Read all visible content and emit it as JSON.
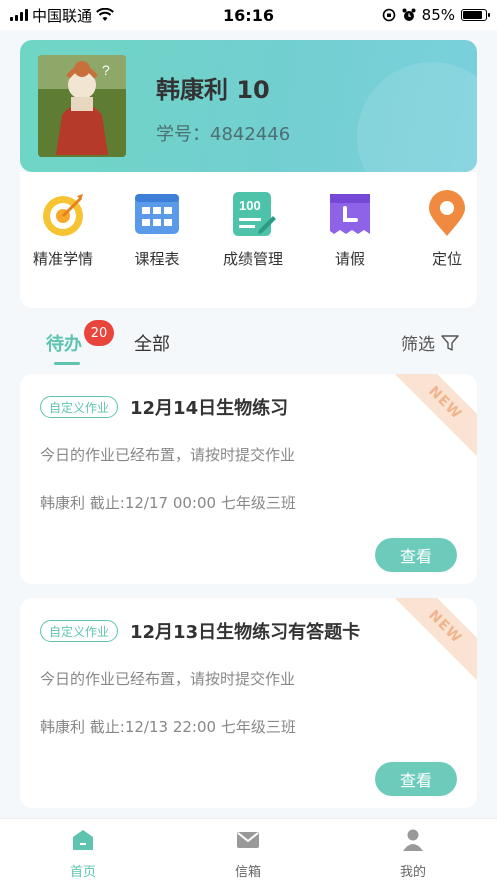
{
  "status_bar": {
    "carrier": "中国联通",
    "time": "16:16",
    "battery": "85%",
    "battery_level": 0.85
  },
  "profile": {
    "name": "韩康利 10",
    "student_id_label": "学号：",
    "student_id": "4842446"
  },
  "quick_actions": [
    {
      "label": "精准学情",
      "icon": "target-icon"
    },
    {
      "label": "课程表",
      "icon": "calendar-grid-icon"
    },
    {
      "label": "成绩管理",
      "icon": "score-icon"
    },
    {
      "label": "请假",
      "icon": "leave-icon"
    },
    {
      "label": "定位",
      "icon": "location-pin-icon"
    }
  ],
  "tabs": {
    "todo": "待办",
    "todo_badge": "20",
    "all": "全部",
    "filter": "筛选"
  },
  "tasks": [
    {
      "tag": "自定义作业",
      "title": "12月14日生物练习",
      "description": "今日的作业已经布置，请按时提交作业",
      "meta": "韩康利 截止:12/17 00:00  七年级三班",
      "button": "查看",
      "ribbon": "NEW"
    },
    {
      "tag": "自定义作业",
      "title": "12月13日生物练习有答题卡",
      "description": "今日的作业已经布置，请按时提交作业",
      "meta": "韩康利 截止:12/13 22:00  七年级三班",
      "button": "查看",
      "ribbon": "NEW"
    }
  ],
  "bottom_nav": [
    {
      "label": "首页",
      "icon": "home-icon",
      "active": true
    },
    {
      "label": "信箱",
      "icon": "mail-icon",
      "active": false
    },
    {
      "label": "我的",
      "icon": "user-icon",
      "active": false
    }
  ],
  "colors": {
    "accent": "#5ec4b0",
    "badge": "#e8453c",
    "ribbon": "#fbe3d3"
  }
}
